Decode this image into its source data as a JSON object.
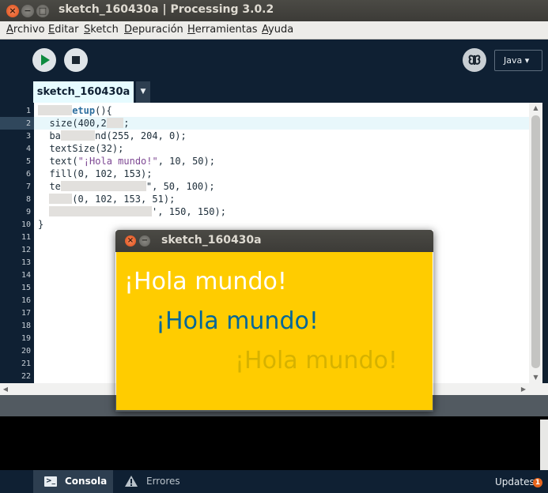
{
  "window": {
    "title": "sketch_160430a | Processing 3.0.2",
    "close_glyph": "×",
    "min_glyph": "−",
    "max_glyph": "□"
  },
  "menubar": {
    "items": [
      "Archivo",
      "Editar",
      "Sketch",
      "Depuración",
      "Herramientas",
      "Ayuda"
    ]
  },
  "toolbar": {
    "mode": "Java ▾",
    "run_icon": "play-icon",
    "stop_icon": "stop-icon",
    "debug_icon": "butterfly-icon"
  },
  "tabs": {
    "active": "sketch_160430a",
    "menu_glyph": "▼"
  },
  "editor": {
    "line_numbers": [
      "1",
      "2",
      "3",
      "4",
      "5",
      "6",
      "7",
      "8",
      "9",
      "10",
      "11",
      "12",
      "13",
      "14",
      "15",
      "16",
      "17",
      "18",
      "19",
      "20",
      "21",
      "22"
    ],
    "lines": [
      {
        "pre": "",
        "redact_chars": 6,
        "post_kw": "etup",
        "post": "(){"
      },
      {
        "pre": "  size(400,2",
        "redact_chars": 3,
        "post_kw": "",
        "post": ";"
      },
      {
        "pre": "  ba",
        "redact_chars": 6,
        "post_kw": "",
        "post": "nd(255, 204, 0);"
      },
      {
        "pre": "  textSize(32);",
        "redact_chars": 0,
        "post_kw": "",
        "post": ""
      },
      {
        "pre": "  text(",
        "redact_chars": 0,
        "post_kw": "",
        "post": ", 10, 50);",
        "str": "\"¡Hola mundo!\""
      },
      {
        "pre": "  fill(0, 102, 153);",
        "redact_chars": 0,
        "post_kw": "",
        "post": ""
      },
      {
        "pre": "  te",
        "redact_chars": 15,
        "post_kw": "",
        "post": "\", 50, 100);"
      },
      {
        "pre": "  ",
        "redact_chars": 4,
        "post_kw": "",
        "post": "(0, 102, 153, 51);"
      },
      {
        "pre": "  ",
        "redact_chars": 18,
        "post_kw": "",
        "post": "', 150, 150);"
      },
      {
        "pre": "}",
        "redact_chars": 0,
        "post_kw": "",
        "post": ""
      }
    ]
  },
  "console_tabs": {
    "console": "Consola",
    "errors": "Errores",
    "console_icon_glyph": ">_"
  },
  "updates": {
    "label": "Updates",
    "count": "1"
  },
  "sketch_window": {
    "title": "sketch_160430a",
    "background": "#ffcc00",
    "texts": [
      {
        "text": "¡Hola mundo!",
        "color": "#ffffff"
      },
      {
        "text": "¡Hola mundo!",
        "color": "#006699"
      },
      {
        "text": "¡Hola mundo!",
        "color": "#d6b200"
      }
    ]
  }
}
